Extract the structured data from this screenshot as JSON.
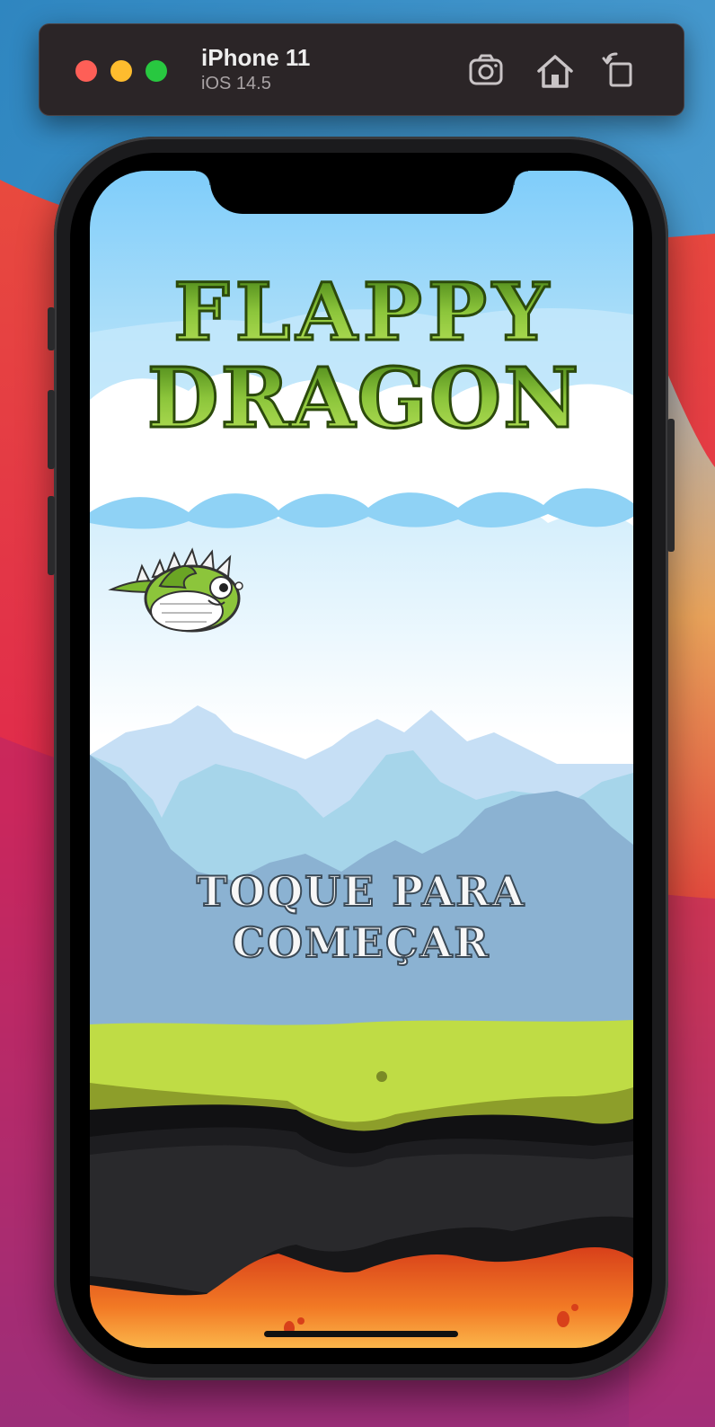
{
  "toolbar": {
    "device_name": "iPhone 11",
    "os_version": "iOS 14.5",
    "buttons": [
      {
        "icon": "camera-icon",
        "label": "Screenshot"
      },
      {
        "icon": "home-icon",
        "label": "Home"
      },
      {
        "icon": "rotate-icon",
        "label": "Rotate"
      }
    ]
  },
  "game": {
    "title_line1": "FLAPPY",
    "title_line2": "DRAGON",
    "tap_line1": "TOQUE PARA",
    "tap_line2": "COMEÇAR"
  },
  "colors": {
    "sky_top": "#7fcdfa",
    "title_green": "#6ea829",
    "grass": "#bfdc45",
    "lava": "#e8541a"
  }
}
